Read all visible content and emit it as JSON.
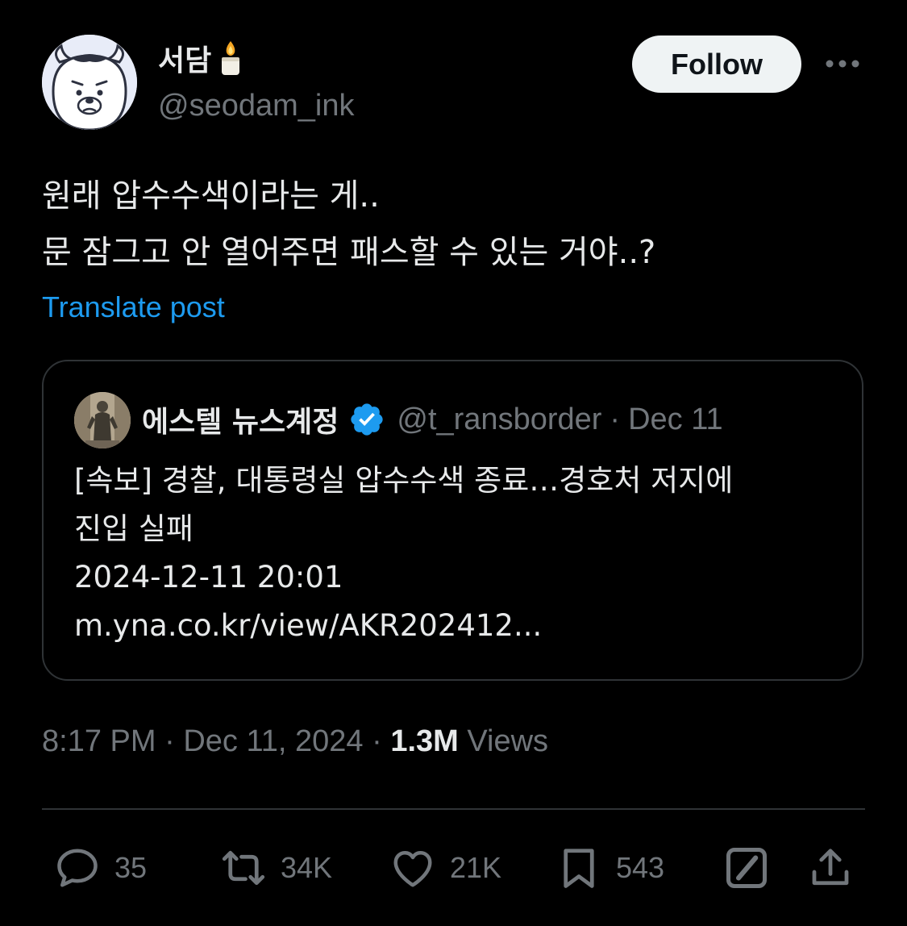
{
  "author": {
    "display_name": "서담",
    "handle": "@seodam_ink",
    "avatar_icon": "polar-bear-avatar",
    "emoji_icon": "candle-icon"
  },
  "follow_label": "Follow",
  "more_icon": "ellipsis-icon",
  "post": {
    "lines": [
      "원래 압수수색이라는 게..",
      "문 잠그고 안 열어주면 패스할 수 있는 거야..?"
    ],
    "translate_label": "Translate post"
  },
  "quote": {
    "display_name": "에스텔 뉴스계정",
    "verified_icon": "verified-badge-icon",
    "handle": "@t_ransborder",
    "separator": "·",
    "date": "Dec 11",
    "lines": [
      "[속보] 경찰, 대통령실 압수수색 종료…경호처 저지에",
      "진입 실패",
      "2024-12-11 20:01",
      "m.yna.co.kr/view/AKR202412..."
    ]
  },
  "meta": {
    "time": "8:17 PM",
    "separator": "·",
    "date": "Dec 11, 2024",
    "separator2": "·",
    "views_count": "1.3M",
    "views_label": "Views"
  },
  "actions": {
    "replies": "35",
    "reposts": "34K",
    "likes": "21K",
    "bookmarks": "543"
  },
  "colors": {
    "background": "#000000",
    "text": "#e7e9ea",
    "muted": "#71767b",
    "link": "#1d9bf0",
    "border": "#2f3336",
    "button_bg": "#eff3f4"
  }
}
